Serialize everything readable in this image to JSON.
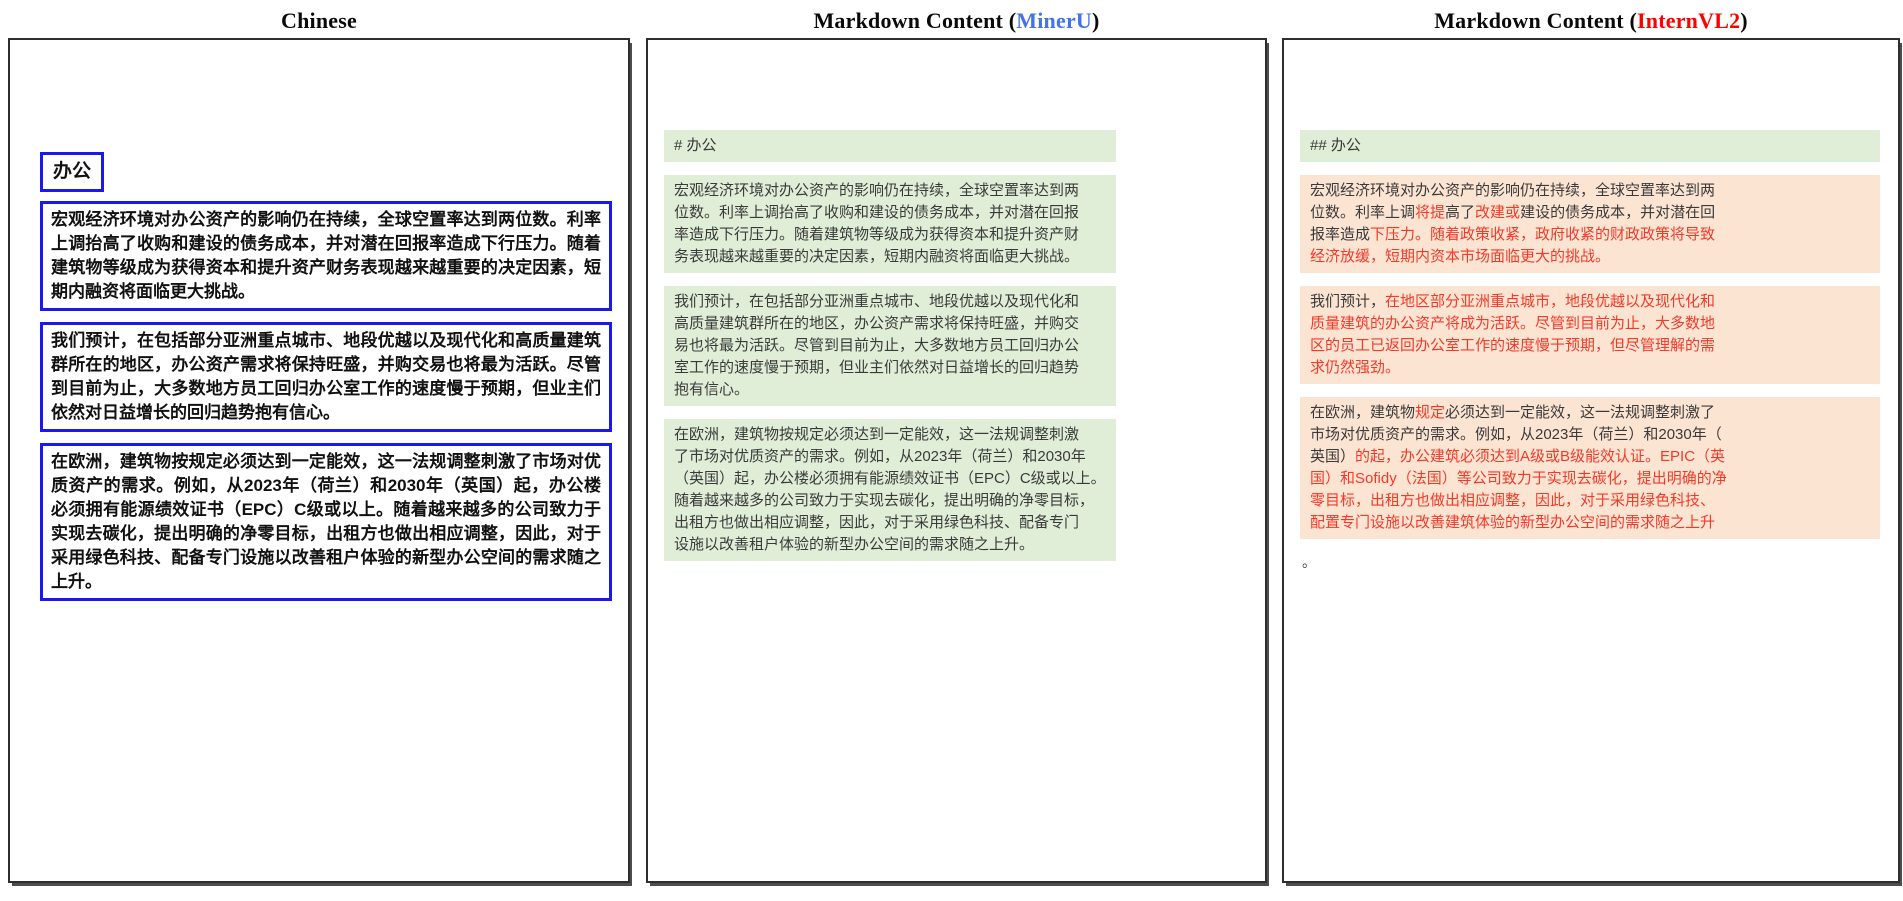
{
  "titles": {
    "left": "Chinese",
    "middle": {
      "prefix": "Markdown Content (",
      "model": "MinerU",
      "suffix": ")"
    },
    "right": {
      "prefix": "Markdown Content (",
      "model": "InternVL2",
      "suffix": ")"
    }
  },
  "colors": {
    "blue_border": "#1a18ee",
    "green_highlight": "#e0eed8",
    "peach_highlight": "#fce4d3",
    "error_red": "#f23a29",
    "mineru_blue": "#4472e8",
    "internvl_red": "#ff0000",
    "panel_border": "#2e2e2e"
  },
  "chinese": {
    "heading": "办公",
    "paragraphs": [
      "宏观经济环境对办公资产的影响仍在持续，全球空置率达到两位数。利率上调抬高了收购和建设的债务成本，并对潜在回报率造成下行压力。随着建筑物等级成为获得资本和提升资产财务表现越来越重要的决定因素，短期内融资将面临更大挑战。",
      "我们预计，在包括部分亚洲重点城市、地段优越以及现代化和高质量建筑群所在的地区，办公资产需求将保持旺盛，并购交易也将最为活跃。尽管到目前为止，大多数地方员工回归办公室工作的速度慢于预期，但业主们依然对日益增长的回归趋势抱有信心。",
      "在欧洲，建筑物按规定必须达到一定能效，这一法规调整刺激了市场对优质资产的需求。例如，从2023年（荷兰）和2030年（英国）起，办公楼必须拥有能源绩效证书（EPC）C级或以上。随着越来越多的公司致力于实现去碳化，提出明确的净零目标，出租方也做出相应调整，因此，对于采用绿色科技、配备专门设施以改善租户体验的新型办公空间的需求随之上升。"
    ]
  },
  "mineru": {
    "blocks": [
      "# 办公",
      "宏观经济环境对办公资产的影响仍在持续，全球空置率达到两\n位数。利率上调抬高了收购和建设的债务成本，并对潜在回报\n率造成下行压力。随着建筑物等级成为获得资本和提升资产财\n务表现越来越重要的决定因素，短期内融资将面临更大挑战。",
      "我们预计，在包括部分亚洲重点城市、地段优越以及现代化和\n高质量建筑群所在的地区，办公资产需求将保持旺盛，并购交\n易也将最为活跃。尽管到目前为止，大多数地方员工回归办公\n室工作的速度慢于预期，但业主们依然对日益增长的回归趋势\n抱有信心。",
      "在欧洲，建筑物按规定必须达到一定能效，这一法规调整刺激\n了市场对优质资产的需求。例如，从2023年（荷兰）和2030年\n（英国）起，办公楼必须拥有能源绩效证书（EPC）C级或以上。\n随着越来越多的公司致力于实现去碳化，提出明确的净零目标，\n出租方也做出相应调整，因此，对于采用绿色科技、配备专门\n设施以改善租户体验的新型办公空间的需求随之上升。"
    ]
  },
  "internvl2": {
    "heading": "## 办公",
    "blocks": [
      {
        "segments": [
          {
            "color": "black",
            "text": "宏观经济环境对办公资产的影响仍在持续，全球空置率达到两\n位数。利率上调"
          },
          {
            "color": "red",
            "text": "将提"
          },
          {
            "color": "black",
            "text": "高了"
          },
          {
            "color": "red",
            "text": "改建或"
          },
          {
            "color": "black",
            "text": "建设的债务成本，并对潜在回\n报率造成"
          },
          {
            "color": "red",
            "text": "下压力。随着政策收紧，政府收紧的财政政策将导致\n经济放缓，短期内资本市场面临更大的挑战。"
          }
        ]
      },
      {
        "segments": [
          {
            "color": "black",
            "text": "我们预计，"
          },
          {
            "color": "red",
            "text": "在地区部分亚洲重点城市，地段优越以及现代化和\n质量建筑的办公资产将成为活跃。尽管到目前为止，大多数地\n区的员工已返回办公室工作的速度慢于预期，但尽管理解的需\n求仍然强劲。"
          }
        ]
      },
      {
        "segments": [
          {
            "color": "black",
            "text": "在欧洲，建筑物"
          },
          {
            "color": "red",
            "text": "规定"
          },
          {
            "color": "black",
            "text": "必须达到一定能效，这一法规调整刺激了\n市场对优质资产的需求。例如，从2023年（荷兰）和2030年（\n英国）"
          },
          {
            "color": "red",
            "text": "的起，办公建筑必须达到A级或B级能效认证。EPIC（英\n国）和Sofidy（法国）等公司致力于实现去碳化，提出明确的净\n零目标，出租方也做出相应调整，因此，对于采用绿色科技、\n配置专门设施以改善建筑体验的新型办公空间的需求随之上升"
          }
        ]
      }
    ],
    "trailing": "。"
  }
}
